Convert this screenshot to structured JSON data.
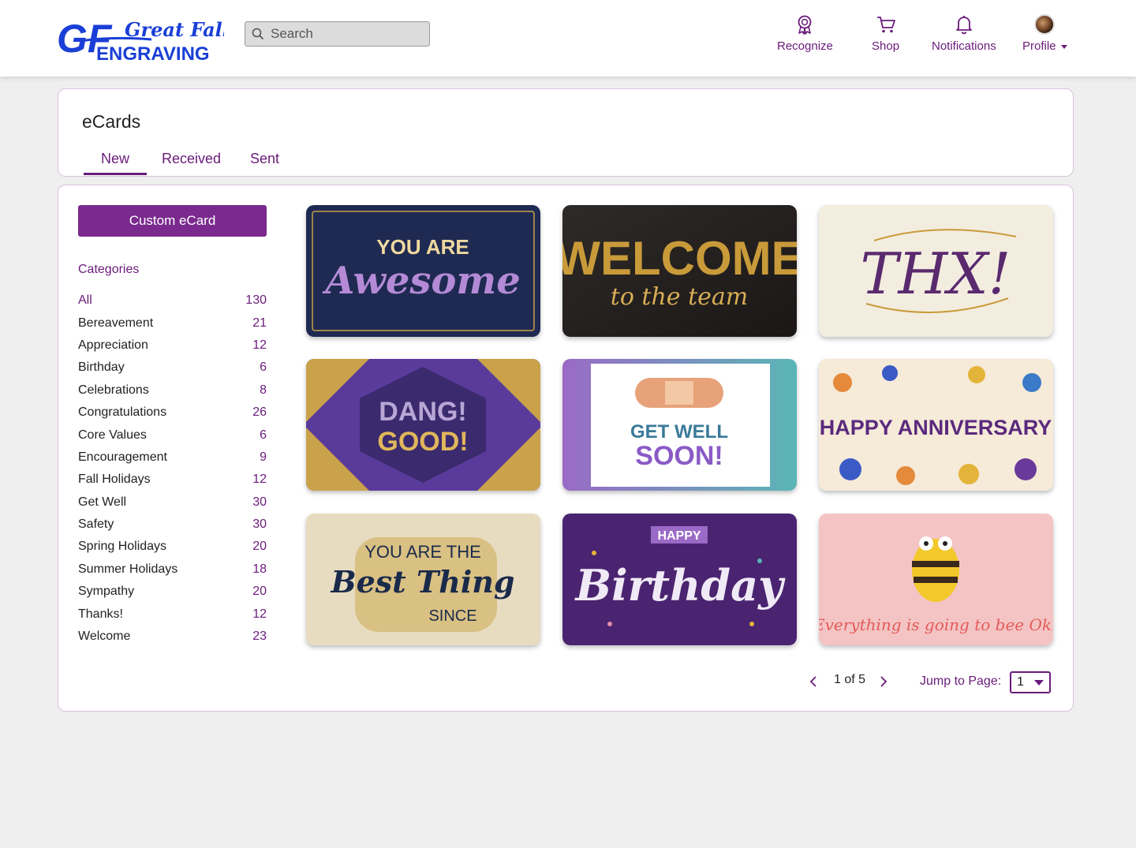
{
  "brand": {
    "logo_line1": "Great Falls",
    "logo_line2": "ENGRAVING",
    "logo_mark": "GF"
  },
  "search": {
    "placeholder": "Search"
  },
  "nav": [
    {
      "label": "Recognize",
      "icon": "award-icon"
    },
    {
      "label": "Shop",
      "icon": "cart-icon"
    },
    {
      "label": "Notifications",
      "icon": "bell-icon"
    },
    {
      "label": "Profile",
      "icon": "avatar"
    }
  ],
  "page": {
    "title": "eCards",
    "tabs": [
      {
        "label": "New",
        "active": true
      },
      {
        "label": "Received",
        "active": false
      },
      {
        "label": "Sent",
        "active": false
      }
    ]
  },
  "sidebar": {
    "custom_button": "Custom eCard",
    "categories_heading": "Categories",
    "categories": [
      {
        "name": "All",
        "count": "130"
      },
      {
        "name": "Bereavement",
        "count": "21"
      },
      {
        "name": "Appreciation",
        "count": "12"
      },
      {
        "name": "Birthday",
        "count": "6"
      },
      {
        "name": "Celebrations",
        "count": "8"
      },
      {
        "name": "Congratulations",
        "count": "26"
      },
      {
        "name": "Core Values",
        "count": "6"
      },
      {
        "name": "Encouragement",
        "count": "9"
      },
      {
        "name": "Fall Holidays",
        "count": "12"
      },
      {
        "name": "Get Well",
        "count": "30"
      },
      {
        "name": "Safety",
        "count": "30"
      },
      {
        "name": "Spring Holidays",
        "count": "20"
      },
      {
        "name": "Summer Holidays",
        "count": "18"
      },
      {
        "name": "Sympathy",
        "count": "20"
      },
      {
        "name": "Thanks!",
        "count": "12"
      },
      {
        "name": "Welcome",
        "count": "23"
      }
    ]
  },
  "ecards": [
    {
      "line1": "YOU ARE",
      "line2": "Awesome"
    },
    {
      "line1": "WELCOME",
      "line2": "to the team"
    },
    {
      "line1": "THX!"
    },
    {
      "line1": "DANG!",
      "line2": "GOOD!"
    },
    {
      "line1": "GET WELL",
      "line2": "SOON!"
    },
    {
      "line1": "HAPPY ANNIVERSARY"
    },
    {
      "line1": "YOU ARE THE",
      "line2": "Best Thing",
      "line3": "SINCE"
    },
    {
      "line1": "HAPPY",
      "line2": "Birthday"
    },
    {
      "line1": "Everything is going to bee Ok!"
    }
  ],
  "pagination": {
    "status": "1 of 5",
    "jump_label": "Jump to Page:",
    "jump_value": "1"
  },
  "colors": {
    "accent": "#6a1b7a",
    "button": "#7a2a8e",
    "logo_blue": "#1a3fd6"
  }
}
